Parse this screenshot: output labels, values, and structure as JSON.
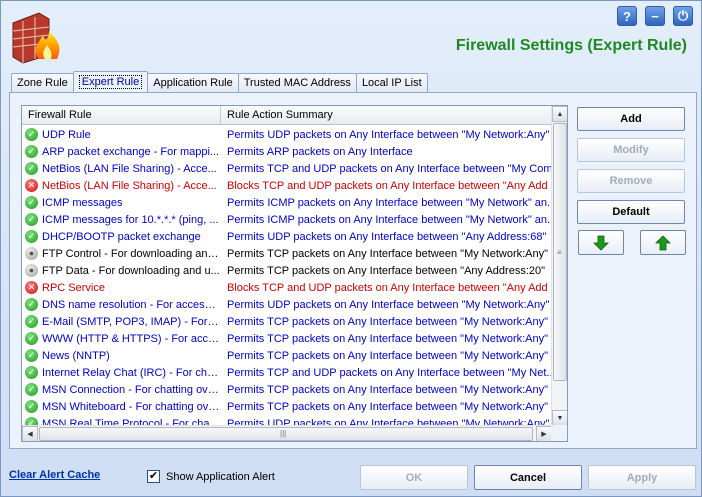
{
  "header": {
    "title": "Firewall Settings (Expert Rule)",
    "help_glyph": "?",
    "minimize_glyph": "−",
    "power_glyph": "⏻"
  },
  "tabs": [
    {
      "label": "Zone Rule",
      "active": false
    },
    {
      "label": "Expert Rule",
      "active": true
    },
    {
      "label": "Application Rule",
      "active": false
    },
    {
      "label": "Trusted MAC Address",
      "active": false
    },
    {
      "label": "Local IP List",
      "active": false
    }
  ],
  "table": {
    "columns": [
      "Firewall Rule",
      "Rule Action Summary"
    ],
    "rows": [
      {
        "status": "enabled",
        "rule": "UDP Rule",
        "summary": "Permits UDP packets on Any Interface between \"My Network:Any\""
      },
      {
        "status": "enabled",
        "rule": "ARP packet exchange - For mappi...",
        "summary": "Permits ARP packets on Any Interface"
      },
      {
        "status": "enabled",
        "rule": "NetBios (LAN File Sharing) - Acce...",
        "summary": "Permits TCP and UDP packets on Any Interface between \"My Com..."
      },
      {
        "status": "blocked",
        "rule": "NetBios (LAN File Sharing) - Acce...",
        "summary": "Blocks TCP and UDP packets on Any Interface between \"Any Add"
      },
      {
        "status": "enabled",
        "rule": "ICMP messages",
        "summary": "Permits ICMP packets on Any Interface between \"My Network\" an..."
      },
      {
        "status": "enabled",
        "rule": "ICMP messages  for  10.*.*.* (ping, ...",
        "summary": "Permits ICMP packets on Any Interface between \"My Network\" an..."
      },
      {
        "status": "enabled",
        "rule": "DHCP/BOOTP packet exchange",
        "summary": "Permits UDP packets on Any Interface between \"Any Address:68\""
      },
      {
        "status": "disabled",
        "rule": "FTP Control - For downloading and...",
        "summary": "Permits TCP packets on Any Interface between \"My Network:Any\""
      },
      {
        "status": "disabled",
        "rule": "FTP Data - For downloading and u...",
        "summary": "Permits TCP packets on Any Interface between \"Any Address:20\""
      },
      {
        "status": "blocked",
        "rule": "RPC Service",
        "summary": "Blocks TCP and UDP packets on Any Interface between \"Any Add"
      },
      {
        "status": "enabled",
        "rule": "DNS name resolution - For accessi...",
        "summary": "Permits UDP packets on Any Interface between \"My Network:Any\""
      },
      {
        "status": "enabled",
        "rule": "E-Mail (SMTP, POP3, IMAP) - For se...",
        "summary": "Permits TCP packets on Any Interface between \"My Network:Any\""
      },
      {
        "status": "enabled",
        "rule": "WWW (HTTP & HTTPS) - For acce...",
        "summary": "Permits TCP packets on Any Interface between \"My Network:Any\""
      },
      {
        "status": "enabled",
        "rule": "News (NNTP)",
        "summary": "Permits TCP packets on Any Interface between \"My Network:Any\""
      },
      {
        "status": "enabled",
        "rule": "Internet Relay Chat (IRC) - For chat...",
        "summary": "Permits TCP and UDP packets on Any Interface between \"My Net..."
      },
      {
        "status": "enabled",
        "rule": "MSN Connection - For chatting ove...",
        "summary": "Permits TCP packets on Any Interface between \"My Network:Any\""
      },
      {
        "status": "enabled",
        "rule": "MSN Whiteboard - For chatting ove...",
        "summary": "Permits TCP packets on Any Interface between \"My Network:Any\""
      },
      {
        "status": "enabled",
        "rule": "MSN Real Time Protocol - For chatti...",
        "summary": "Permits UDP packets on Any Interface between \"My Network:Any\""
      }
    ]
  },
  "side_buttons": {
    "add": "Add",
    "modify": "Modify",
    "remove": "Remove",
    "default": "Default"
  },
  "footer": {
    "clear_alert": "Clear Alert Cache",
    "show_alert_label": "Show Application Alert",
    "show_alert_checked": true,
    "check_glyph": "✔",
    "ok": "OK",
    "cancel": "Cancel",
    "apply": "Apply"
  },
  "colors": {
    "permit": "#0000cc",
    "block": "#d10000",
    "title": "#1e8a1e",
    "arrow": "#1a9a1a"
  }
}
